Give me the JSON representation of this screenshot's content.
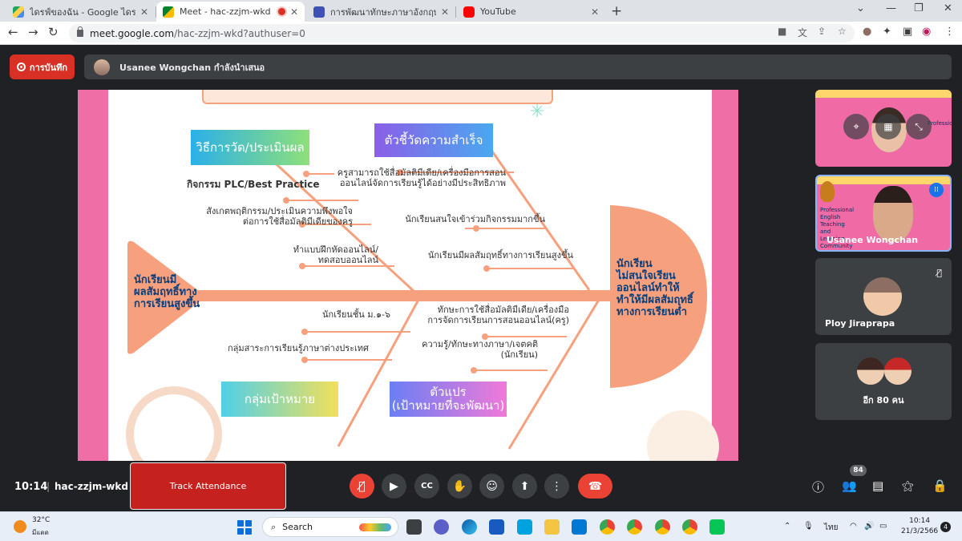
{
  "browser": {
    "tabs": [
      {
        "title": "ไดรฟ์ของฉัน - Google ไดรฟ์",
        "color": "#1fa463"
      },
      {
        "title": "Meet - hac-zzjm-wkd",
        "color": "#00832d"
      },
      {
        "title": "การพัฒนาทักษะภาษาอังกฤษ English",
        "color": "#3f51b5"
      },
      {
        "title": "YouTube",
        "color": "#ff0000"
      }
    ],
    "url_host": "meet.google.com",
    "url_path": "/hac-zzjm-wkd?authuser=0"
  },
  "meet": {
    "recording_label": "การบันทึก",
    "presenting_text": "Usanee Wongchan กำลังนำเสนอ",
    "time": "10:14",
    "meeting_code": "hac-zzjm-wkd",
    "track_attendance_label": "Track Attendance",
    "participant_count": "84",
    "participants": [
      {
        "name": ""
      },
      {
        "name": "Usanee Wongchan"
      },
      {
        "name": "Ploy Jiraprapa"
      },
      {
        "name": "อีก 80 คน"
      }
    ],
    "tile_slide_text": [
      "Professional",
      "English",
      "Teaching",
      "and",
      "Learning",
      "Community"
    ]
  },
  "slide": {
    "headings": {
      "measure": "วิธีการวัด/ประเมินผล",
      "indicators": "ตัวชี้วัดความสำเร็จ",
      "target": "กลุ่มเป้าหมาย",
      "variables": "ตัวแปร\n(เป้าหมายที่จะพัฒนา)"
    },
    "texts": {
      "plc": "กิจกรรม PLC/Best Practice",
      "observe": "สังเกตพฤติกรรม/ประเมินความพึงพอใจ\nต่อการใช้สื่อมัลติมีเดียของครู",
      "exercise": "ทำแบบฝึกหัดออนไลน์/\nทดสอบออนไลน์",
      "teacher_use": "ครูสามารถใช้สื่อมัลติมีเดีย/เครื่องมือการสอน\nออนไลน์จัดการเรียนรู้ได้อย่างมีประสิทธิภาพ",
      "interest": "นักเรียนสนใจเข้าร่วมกิจกรรมมากขึ้น",
      "achievement": "นักเรียนมีผลสัมฤทธิ์ทางการเรียนสูงขึ้น",
      "grade": "นักเรียนชั้น ม.๑-๖",
      "subject": "กลุ่มสาระการเรียนรู้ภาษาต่างประเทศ",
      "skill": "ทักษะการใช้สื่อมัลติมีเดีย/เครื่องมือ\nการจัดการเรียนการสอนออนไลน์(ครู)",
      "knowledge": "ความรู้/ทักษะทางภาษา/เจตคติ\n(นักเรียน)",
      "left_blob": "นักเรียนมี\nผลสัมฤทธิ์ทาง\nการเรียนสูงขึ้น",
      "right_blob": "นักเรียน\nไม่สนใจเรียน\nออนไลน์ทำให้\nทำให้มีผลสัมฤทธิ์\nทางการเรียนต่ำ"
    }
  },
  "taskbar": {
    "temperature": "32°C",
    "condition": "มีแดด",
    "search_label": "Search",
    "language": "ไทย",
    "time": "10:14",
    "date": "21/3/2566",
    "notifications": "4"
  },
  "colors": {
    "accent_red": "#ea4335",
    "slide_pink": "#ef6ea6",
    "fish_orange": "#f7a07d"
  }
}
